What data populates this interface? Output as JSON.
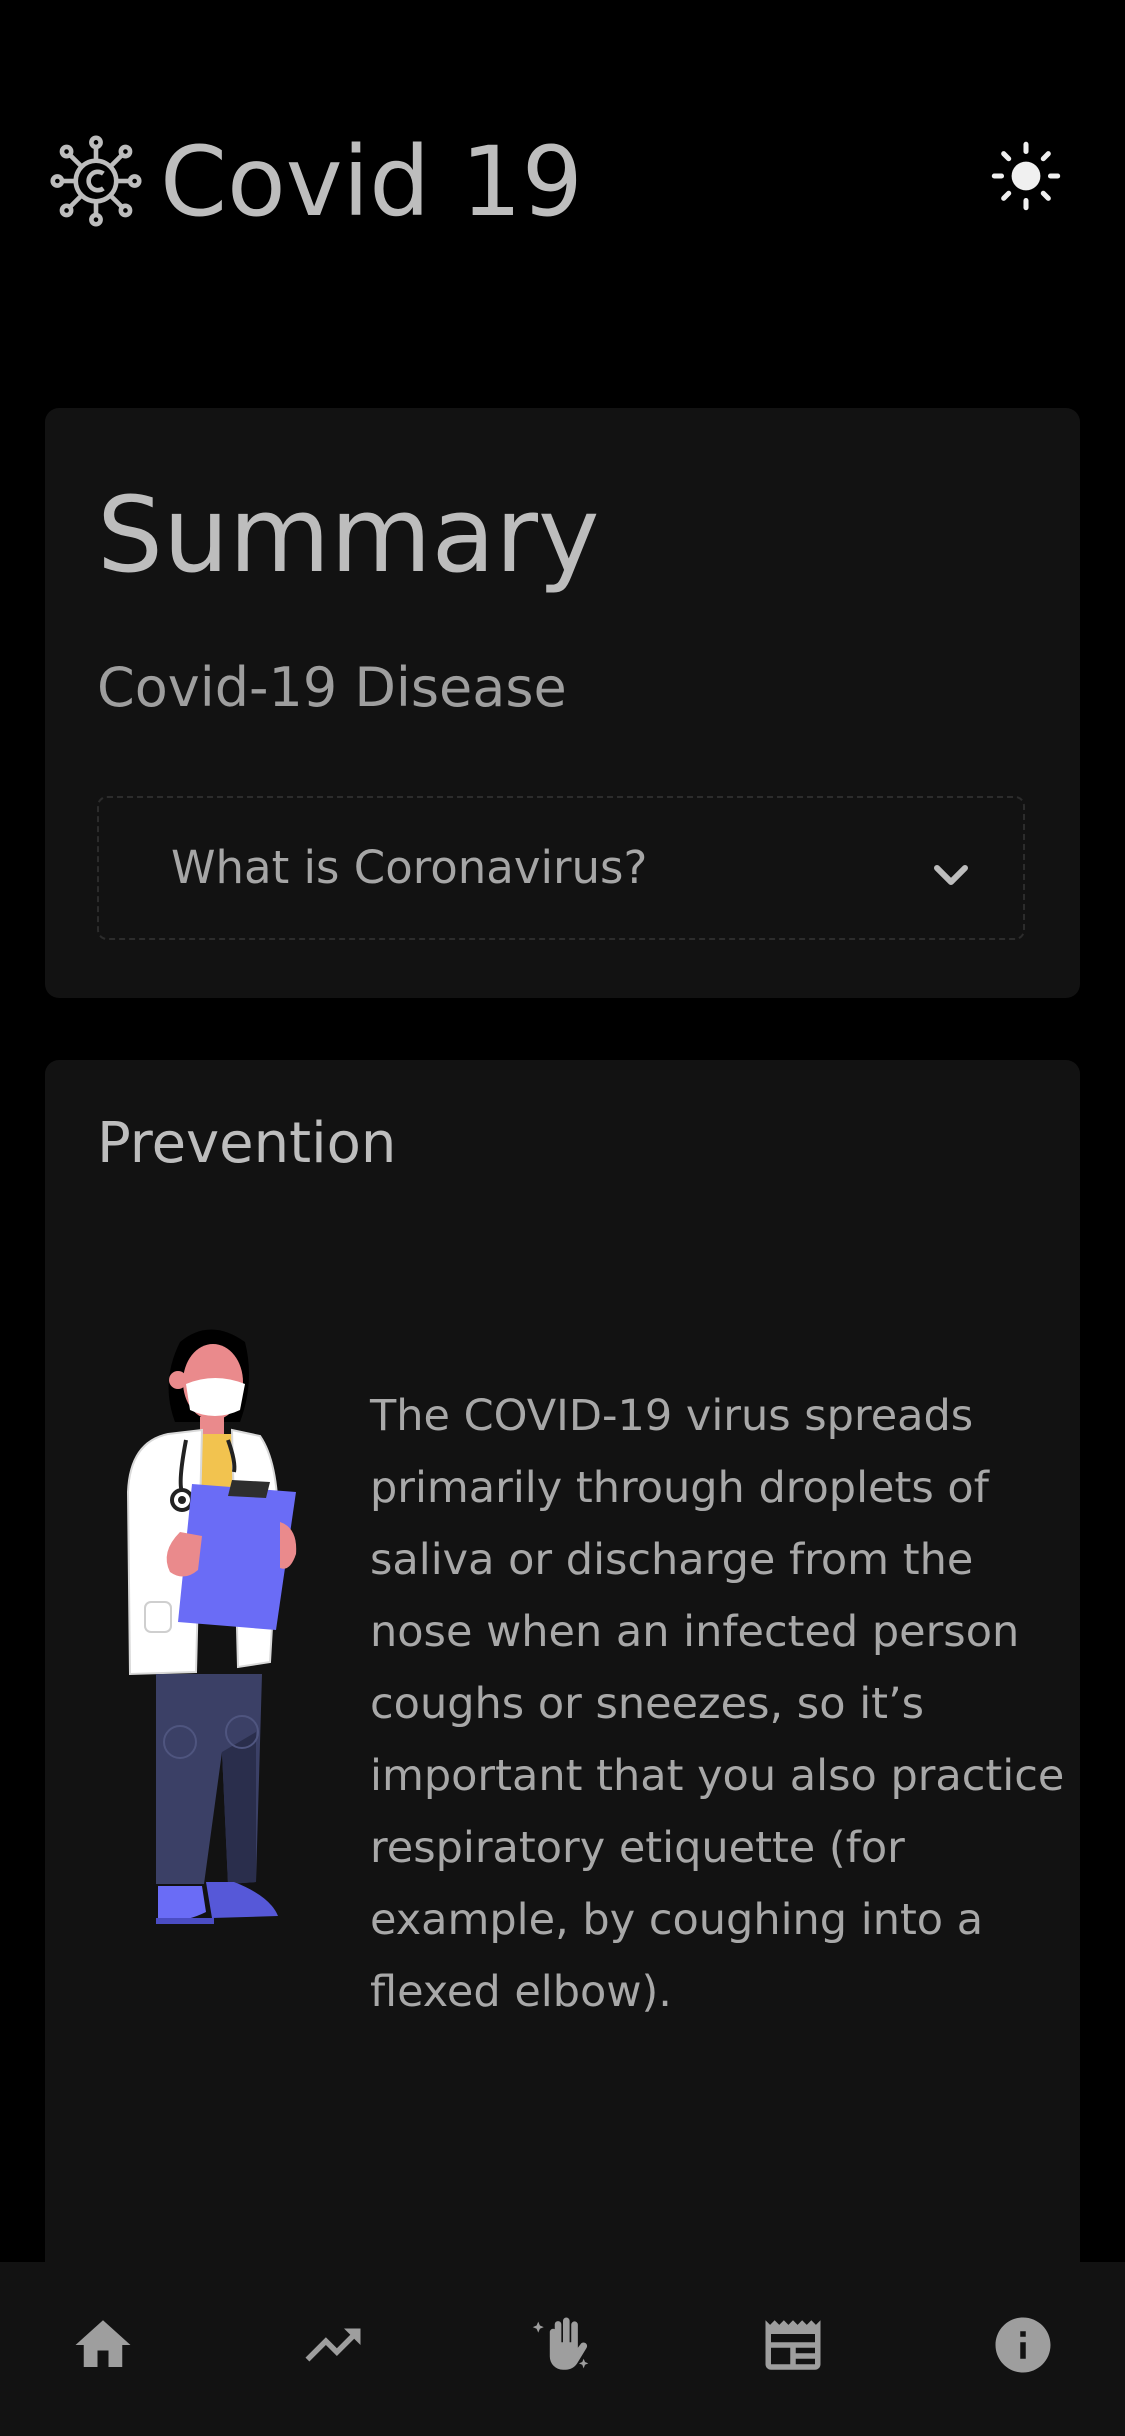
{
  "header": {
    "title": "Covid 19",
    "logo_icon": "coronavirus-icon",
    "theme_toggle_icon": "sun-icon"
  },
  "summary": {
    "title": "Summary",
    "subtitle": "Covid-19 Disease",
    "accordion": {
      "question": "What is Coronavirus?",
      "expanded": false,
      "icon": "chevron-down-icon"
    }
  },
  "prevention": {
    "title": "Prevention",
    "illustration": "doctor-illustration",
    "body": "The COVID-19 virus spreads primarily through droplets of saliva or discharge from the nose when an infected person coughs or sneezes, so it’s important that you also practice respiratory etiquette (for example, by coughing into a flexed elbow)."
  },
  "bottom_nav": {
    "items": [
      {
        "id": "home",
        "icon": "home-icon"
      },
      {
        "id": "trends",
        "icon": "trending-up-icon"
      },
      {
        "id": "prevention",
        "icon": "clean-hands-icon"
      },
      {
        "id": "news",
        "icon": "newspaper-icon"
      },
      {
        "id": "info",
        "icon": "info-icon"
      }
    ]
  },
  "colors": {
    "background": "#000000",
    "card": "#121212",
    "text": "#bdbdbd",
    "text_muted": "#9e9e9e",
    "accent_purple": "#6a6cf6",
    "skin": "#ea8a8c"
  }
}
